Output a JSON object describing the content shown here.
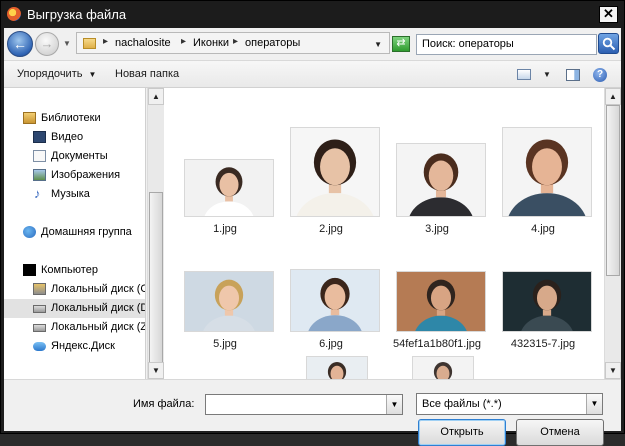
{
  "window": {
    "title": "Выгрузка файла",
    "icon": "firefox-icon"
  },
  "address_bar": {
    "crumbs": [
      "nachalosite",
      "Иконки",
      "операторы"
    ],
    "separator": "▸"
  },
  "search": {
    "value": "Поиск: операторы"
  },
  "toolbar": {
    "organize_label": "Упорядочить",
    "new_folder_label": "Новая папка"
  },
  "navigation": {
    "items": [
      {
        "label": "Библиотеки",
        "icon": "library-icon"
      },
      {
        "label": "Видео",
        "icon": "video-icon"
      },
      {
        "label": "Документы",
        "icon": "documents-icon"
      },
      {
        "label": "Изображения",
        "icon": "images-icon"
      },
      {
        "label": "Музыка",
        "icon": "music-icon"
      },
      {
        "label": "Домашняя группа",
        "icon": "homegroup-icon"
      },
      {
        "label": "Компьютер",
        "icon": "computer-icon"
      },
      {
        "label": "Локальный диск (C",
        "icon": "system-disk-icon"
      },
      {
        "label": "Локальный диск (D",
        "icon": "disk-icon",
        "selected": true
      },
      {
        "label": "Локальный диск (Z",
        "icon": "disk-icon"
      },
      {
        "label": "Яндекс.Диск",
        "icon": "yandex-disk-icon"
      }
    ]
  },
  "files": [
    {
      "name": "1.jpg",
      "bg": "#f2f2f2",
      "skin": "#e9c0a4",
      "hair": "#3a2a22",
      "clothes": "#ffffff"
    },
    {
      "name": "2.jpg",
      "bg": "#f6f6f6",
      "skin": "#e7c2a6",
      "hair": "#2e1f18",
      "clothes": "#f4f1ea"
    },
    {
      "name": "3.jpg",
      "bg": "#f4f4f4",
      "skin": "#e4b79a",
      "hair": "#4a2c1d",
      "clothes": "#2c2c30"
    },
    {
      "name": "4.jpg",
      "bg": "#f4f4f4",
      "skin": "#e6b495",
      "hair": "#5a3422",
      "clothes": "#3a4f63"
    },
    {
      "name": "5.jpg",
      "bg": "#ced9e3",
      "skin": "#efc7ab",
      "hair": "#c8a25a",
      "clothes": "#d6dee6"
    },
    {
      "name": "6.jpg",
      "bg": "#dfe9f2",
      "skin": "#e9bc9e",
      "hair": "#3b261b",
      "clothes": "#8aa7c9"
    },
    {
      "name": "54fef1a1b80f1.jpg",
      "bg": "#b57b54",
      "skin": "#d8a483",
      "hair": "#2f241e",
      "clothes": "#2e87a8"
    },
    {
      "name": "432315-7.jpg",
      "bg": "#1e2d33",
      "skin": "#d7a98a",
      "hair": "#2a211c",
      "clothes": "#3a4a52"
    },
    {
      "name": "",
      "bg": "#e9eef2",
      "skin": "#e2b396",
      "hair": "#3a2d26",
      "clothes": "#e9eef2"
    },
    {
      "name": "",
      "bg": "#f3f3f3",
      "skin": "#d9ac8f",
      "hair": "#3e3430",
      "clothes": "#f3f3f3"
    }
  ],
  "footer": {
    "filename_label": "Имя файла:",
    "filename_value": "",
    "filetype_value": "Все файлы (*.*)",
    "open_label": "Открыть",
    "cancel_label": "Отмена"
  }
}
